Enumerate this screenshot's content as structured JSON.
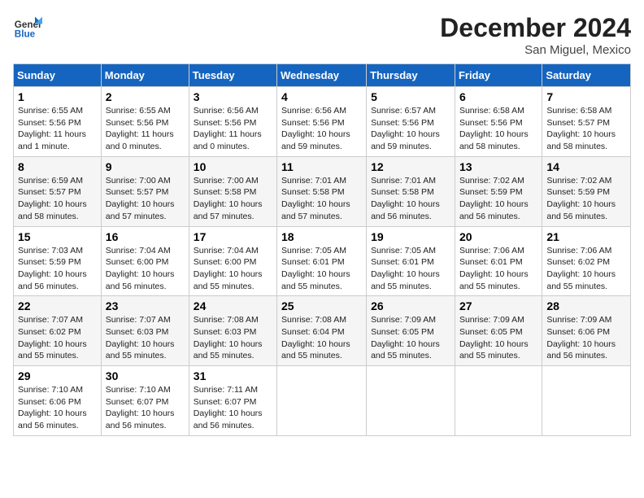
{
  "header": {
    "logo_general": "General",
    "logo_blue": "Blue",
    "month_title": "December 2024",
    "location": "San Miguel, Mexico"
  },
  "days_of_week": [
    "Sunday",
    "Monday",
    "Tuesday",
    "Wednesday",
    "Thursday",
    "Friday",
    "Saturday"
  ],
  "weeks": [
    [
      {
        "day": "1",
        "info": "Sunrise: 6:55 AM\nSunset: 5:56 PM\nDaylight: 11 hours and 1 minute."
      },
      {
        "day": "2",
        "info": "Sunrise: 6:55 AM\nSunset: 5:56 PM\nDaylight: 11 hours and 0 minutes."
      },
      {
        "day": "3",
        "info": "Sunrise: 6:56 AM\nSunset: 5:56 PM\nDaylight: 11 hours and 0 minutes."
      },
      {
        "day": "4",
        "info": "Sunrise: 6:56 AM\nSunset: 5:56 PM\nDaylight: 10 hours and 59 minutes."
      },
      {
        "day": "5",
        "info": "Sunrise: 6:57 AM\nSunset: 5:56 PM\nDaylight: 10 hours and 59 minutes."
      },
      {
        "day": "6",
        "info": "Sunrise: 6:58 AM\nSunset: 5:56 PM\nDaylight: 10 hours and 58 minutes."
      },
      {
        "day": "7",
        "info": "Sunrise: 6:58 AM\nSunset: 5:57 PM\nDaylight: 10 hours and 58 minutes."
      }
    ],
    [
      {
        "day": "8",
        "info": "Sunrise: 6:59 AM\nSunset: 5:57 PM\nDaylight: 10 hours and 58 minutes."
      },
      {
        "day": "9",
        "info": "Sunrise: 7:00 AM\nSunset: 5:57 PM\nDaylight: 10 hours and 57 minutes."
      },
      {
        "day": "10",
        "info": "Sunrise: 7:00 AM\nSunset: 5:58 PM\nDaylight: 10 hours and 57 minutes."
      },
      {
        "day": "11",
        "info": "Sunrise: 7:01 AM\nSunset: 5:58 PM\nDaylight: 10 hours and 57 minutes."
      },
      {
        "day": "12",
        "info": "Sunrise: 7:01 AM\nSunset: 5:58 PM\nDaylight: 10 hours and 56 minutes."
      },
      {
        "day": "13",
        "info": "Sunrise: 7:02 AM\nSunset: 5:59 PM\nDaylight: 10 hours and 56 minutes."
      },
      {
        "day": "14",
        "info": "Sunrise: 7:02 AM\nSunset: 5:59 PM\nDaylight: 10 hours and 56 minutes."
      }
    ],
    [
      {
        "day": "15",
        "info": "Sunrise: 7:03 AM\nSunset: 5:59 PM\nDaylight: 10 hours and 56 minutes."
      },
      {
        "day": "16",
        "info": "Sunrise: 7:04 AM\nSunset: 6:00 PM\nDaylight: 10 hours and 56 minutes."
      },
      {
        "day": "17",
        "info": "Sunrise: 7:04 AM\nSunset: 6:00 PM\nDaylight: 10 hours and 55 minutes."
      },
      {
        "day": "18",
        "info": "Sunrise: 7:05 AM\nSunset: 6:01 PM\nDaylight: 10 hours and 55 minutes."
      },
      {
        "day": "19",
        "info": "Sunrise: 7:05 AM\nSunset: 6:01 PM\nDaylight: 10 hours and 55 minutes."
      },
      {
        "day": "20",
        "info": "Sunrise: 7:06 AM\nSunset: 6:01 PM\nDaylight: 10 hours and 55 minutes."
      },
      {
        "day": "21",
        "info": "Sunrise: 7:06 AM\nSunset: 6:02 PM\nDaylight: 10 hours and 55 minutes."
      }
    ],
    [
      {
        "day": "22",
        "info": "Sunrise: 7:07 AM\nSunset: 6:02 PM\nDaylight: 10 hours and 55 minutes."
      },
      {
        "day": "23",
        "info": "Sunrise: 7:07 AM\nSunset: 6:03 PM\nDaylight: 10 hours and 55 minutes."
      },
      {
        "day": "24",
        "info": "Sunrise: 7:08 AM\nSunset: 6:03 PM\nDaylight: 10 hours and 55 minutes."
      },
      {
        "day": "25",
        "info": "Sunrise: 7:08 AM\nSunset: 6:04 PM\nDaylight: 10 hours and 55 minutes."
      },
      {
        "day": "26",
        "info": "Sunrise: 7:09 AM\nSunset: 6:05 PM\nDaylight: 10 hours and 55 minutes."
      },
      {
        "day": "27",
        "info": "Sunrise: 7:09 AM\nSunset: 6:05 PM\nDaylight: 10 hours and 55 minutes."
      },
      {
        "day": "28",
        "info": "Sunrise: 7:09 AM\nSunset: 6:06 PM\nDaylight: 10 hours and 56 minutes."
      }
    ],
    [
      {
        "day": "29",
        "info": "Sunrise: 7:10 AM\nSunset: 6:06 PM\nDaylight: 10 hours and 56 minutes."
      },
      {
        "day": "30",
        "info": "Sunrise: 7:10 AM\nSunset: 6:07 PM\nDaylight: 10 hours and 56 minutes."
      },
      {
        "day": "31",
        "info": "Sunrise: 7:11 AM\nSunset: 6:07 PM\nDaylight: 10 hours and 56 minutes."
      },
      null,
      null,
      null,
      null
    ]
  ]
}
